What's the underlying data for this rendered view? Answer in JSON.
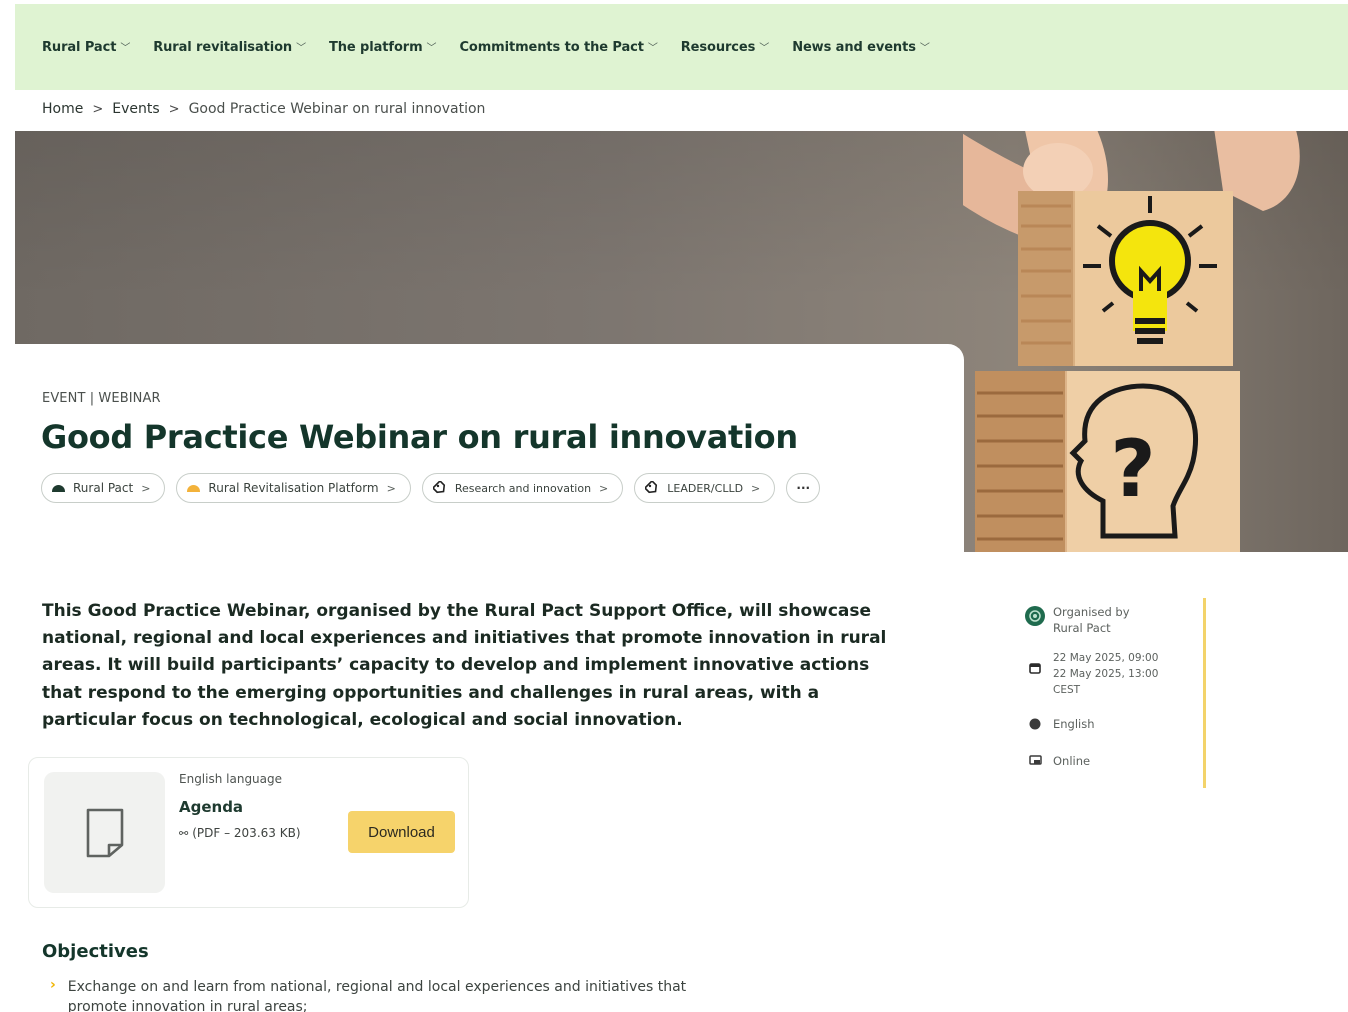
{
  "nav": {
    "items": [
      {
        "label": "Rural Pact"
      },
      {
        "label": "Rural revitalisation"
      },
      {
        "label": "The platform"
      },
      {
        "label": "Commitments to the Pact"
      },
      {
        "label": "Resources"
      },
      {
        "label": "News and events"
      }
    ]
  },
  "breadcrumb": {
    "home": "Home",
    "events": "Events",
    "current": "Good Practice Webinar on rural innovation"
  },
  "event": {
    "type": "EVENT | WEBINAR",
    "title": "Good Practice Webinar on rural innovation"
  },
  "tags": [
    {
      "label": "Rural Pact",
      "color": "#1e3a2f"
    },
    {
      "label": "Rural Revitalisation Platform",
      "color": "#f3b23a"
    },
    {
      "label": "Research and innovation"
    },
    {
      "label": "LEADER/CLLD"
    }
  ],
  "tags_more": "···",
  "intro": "This Good Practice Webinar, organised by the Rural Pact Support Office, will showcase national, regional and local experiences and initiatives that promote innovation in rural areas. It will build participants’ capacity to develop and implement innovative actions that respond to the emerging opportunities and challenges in rural areas, with a particular focus on technological, ecological and social innovation.",
  "meta": {
    "organised_by": "Organised by",
    "organiser": "Rural Pact",
    "date_start": "22 May 2025, 09:00",
    "date_end": "22 May 2025, 13:00",
    "timezone": "CEST",
    "language": "English",
    "format": "Online"
  },
  "download": {
    "language": "English language",
    "title": "Agenda",
    "size": "(PDF – 203.63 KB)",
    "button": "Download"
  },
  "objectives": {
    "title": "Objectives",
    "items": [
      "Exchange on and learn from national, regional and local experiences and initiatives that promote innovation in rural areas;"
    ]
  },
  "colors": {
    "nav_bg": "#dff3d2",
    "accent_yellow": "#f6d36b",
    "title_green": "#14362b"
  }
}
